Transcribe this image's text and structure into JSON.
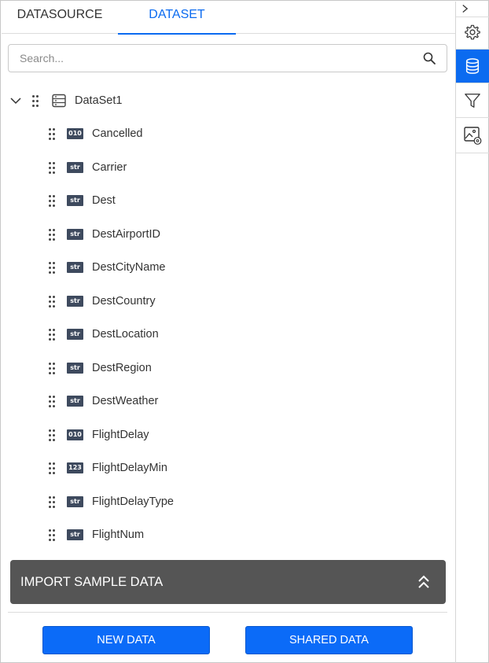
{
  "tabs": [
    {
      "label": "DATASOURCE",
      "active": false
    },
    {
      "label": "DATASET",
      "active": true
    }
  ],
  "search": {
    "placeholder": "Search...",
    "value": ""
  },
  "tree": {
    "root": {
      "label": "DataSet1",
      "expanded": true
    },
    "fields": [
      {
        "label": "Cancelled",
        "type": "010"
      },
      {
        "label": "Carrier",
        "type": "str"
      },
      {
        "label": "Dest",
        "type": "str"
      },
      {
        "label": "DestAirportID",
        "type": "str"
      },
      {
        "label": "DestCityName",
        "type": "str"
      },
      {
        "label": "DestCountry",
        "type": "str"
      },
      {
        "label": "DestLocation",
        "type": "str"
      },
      {
        "label": "DestRegion",
        "type": "str"
      },
      {
        "label": "DestWeather",
        "type": "str"
      },
      {
        "label": "FlightDelay",
        "type": "010"
      },
      {
        "label": "FlightDelayMin",
        "type": "123"
      },
      {
        "label": "FlightDelayType",
        "type": "str"
      },
      {
        "label": "FlightNum",
        "type": "str"
      }
    ]
  },
  "import_panel": {
    "label": "IMPORT SAMPLE DATA",
    "icon": "double-chevron-up-icon"
  },
  "buttons": {
    "new_data": "NEW DATA",
    "shared_data": "SHARED DATA"
  },
  "sidebar": {
    "items": [
      {
        "name": "collapse",
        "icon": "chevron-right-icon",
        "active": false
      },
      {
        "name": "properties",
        "icon": "gear-icon",
        "active": false
      },
      {
        "name": "data",
        "icon": "database-icon",
        "active": true
      },
      {
        "name": "filter",
        "icon": "filter-icon",
        "active": false
      },
      {
        "name": "image-settings",
        "icon": "image-settings-icon",
        "active": false
      }
    ]
  },
  "colors": {
    "accent": "#0b6bf0",
    "import_bg": "#555555",
    "badge_bg": "#3e4a5e"
  }
}
